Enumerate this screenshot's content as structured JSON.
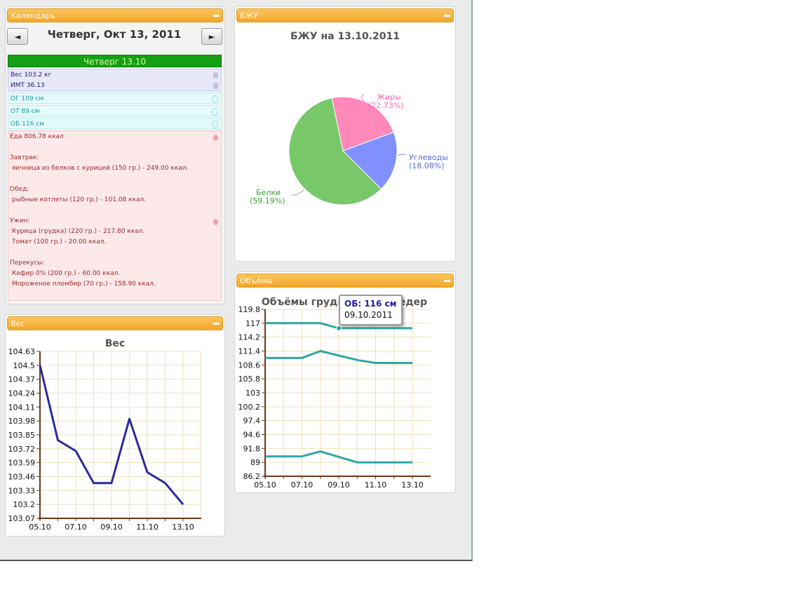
{
  "calendar": {
    "title": "Календарь",
    "prev_label": "◄",
    "next_label": "►",
    "date_label": "Четверг, Окт 13, 2011",
    "day_header": "Четверг 13.10",
    "weight": "Вес 103.2 кг",
    "bmi": "ИМТ 36.13",
    "og": "ОГ 109 см",
    "ot": "ОТ 89 см",
    "ob": "ОБ 116 см",
    "food_total": "Еда 806.78 ккал",
    "meals": [
      {
        "name": "Завтрак:",
        "items": [
          "яичница из белков с курицей (150 гр.) - 249.00 ккал."
        ]
      },
      {
        "name": "Обед:",
        "items": [
          "рыбные котлеты (120 гр.) - 101.08 ккал."
        ]
      },
      {
        "name": "Ужин:",
        "items": [
          "Курица (грудка) (220 гр.) - 217.80 ккал.",
          "Томат (100 гр.) - 20.00 ккал."
        ]
      },
      {
        "name": "Перекусы:",
        "items": [
          "Кефир 0% (200 гр.) - 60.00 ккал.",
          "Мороженое пломбир (70 гр.) - 158.90 ккал."
        ]
      }
    ]
  },
  "bju_panel": {
    "title": "БЖУ",
    "chart_data": {
      "type": "pie",
      "title": "БЖУ на 13.10.2011",
      "slices": [
        {
          "name": "Жиры",
          "value": 22.73,
          "label": "(22.73%)",
          "color": "#ff88bb"
        },
        {
          "name": "Углеводы",
          "value": 18.08,
          "label": "(18.08%)",
          "color": "#8090ff"
        },
        {
          "name": "Белки",
          "value": 59.19,
          "label": "(59.19%)",
          "color": "#78c86a"
        }
      ]
    }
  },
  "weight_panel": {
    "title": "Вес",
    "chart_data": {
      "type": "line",
      "title": "Вес",
      "x": [
        "05.10",
        "06.10",
        "07.10",
        "08.10",
        "09.10",
        "10.10",
        "11.10",
        "12.10",
        "13.10"
      ],
      "x_ticks": [
        "05.10",
        "07.10",
        "09.10",
        "11.10",
        "13.10"
      ],
      "series": [
        {
          "values": [
            104.5,
            103.8,
            103.7,
            103.4,
            103.4,
            104.0,
            103.5,
            103.4,
            103.2
          ],
          "color": "#2b2b9b"
        }
      ],
      "yticks": [
        "104.63",
        "104.5",
        "104.37",
        "104.24",
        "104.11",
        "103.98",
        "103.85",
        "103.72",
        "103.59",
        "103.46",
        "103.33",
        "103.2",
        "103.07"
      ],
      "ylim": [
        103.07,
        104.63
      ],
      "grid": true
    }
  },
  "volumes_panel": {
    "title": "Объёмы",
    "chart_data": {
      "type": "line",
      "title": "Объёмы груди, талии, бедер",
      "x": [
        "05.10",
        "06.10",
        "07.10",
        "08.10",
        "09.10",
        "10.10",
        "11.10",
        "12.10",
        "13.10"
      ],
      "x_ticks": [
        "05.10",
        "07.10",
        "09.10",
        "11.10",
        "13.10"
      ],
      "series": [
        {
          "values": [
            117,
            117,
            117,
            117,
            116,
            116,
            116,
            116,
            116
          ],
          "color": "#2fa6a6"
        },
        {
          "values": [
            110,
            110,
            110,
            111.4,
            110.5,
            109.6,
            109,
            109,
            109
          ],
          "color": "#2fa6a6"
        },
        {
          "values": [
            90.2,
            90.2,
            90.2,
            91.2,
            90.1,
            89,
            89,
            89,
            89
          ],
          "color": "#2fa6a6"
        }
      ],
      "yticks": [
        "119.8",
        "117",
        "114.2",
        "111.4",
        "108.6",
        "105.8",
        "103",
        "100.2",
        "97.4",
        "94.6",
        "91.8",
        "89",
        "86.2"
      ],
      "ylim": [
        86.2,
        119.8
      ],
      "grid": true
    },
    "tooltip": {
      "label": "ОБ: 116 см",
      "date": "09.10.2011"
    }
  }
}
